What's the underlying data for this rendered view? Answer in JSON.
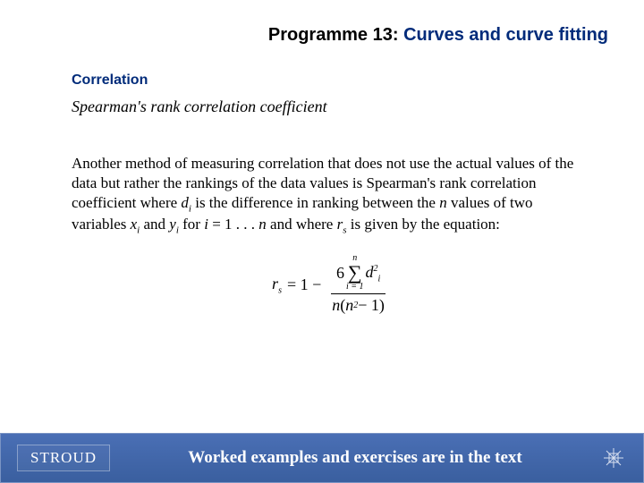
{
  "header": {
    "programme": "Programme 13:",
    "title": "Curves and curve fitting"
  },
  "section": "Correlation",
  "subsection": "Spearman's rank correlation coefficient",
  "body": {
    "prefix": "Another method of measuring correlation that does not use the actual values of the data but rather the rankings of the data values is Spearman's rank correlation coefficient where ",
    "di": "d",
    "di_sub": "i",
    "mid1": " is the difference in ranking between the ",
    "n": "n",
    "mid2": " values of two variables ",
    "xi": "x",
    "xi_sub": "i",
    "and1": " and ",
    "yi": "y",
    "yi_sub": "i",
    "mid3": " for ",
    "ieq": "i",
    "mid4": " = 1 . . . ",
    "n2": "n",
    "mid5": " and where ",
    "rs": "r",
    "rs_sub": "s",
    "tail": " is given by the equation:"
  },
  "formula": {
    "lhs_r": "r",
    "lhs_sub": "s",
    "equals": " = 1 − ",
    "six": "6",
    "sigma_top": "n",
    "sigma_bot": "i = 1",
    "d": "d",
    "d_sub": "i",
    "d_sup": "2",
    "denom_n1": "n",
    "denom_open": "(",
    "denom_n2": "n",
    "denom_sup": "2",
    "denom_tail": " − 1)"
  },
  "footer": {
    "brand": "STROUD",
    "text": "Worked examples and exercises are in the text"
  }
}
